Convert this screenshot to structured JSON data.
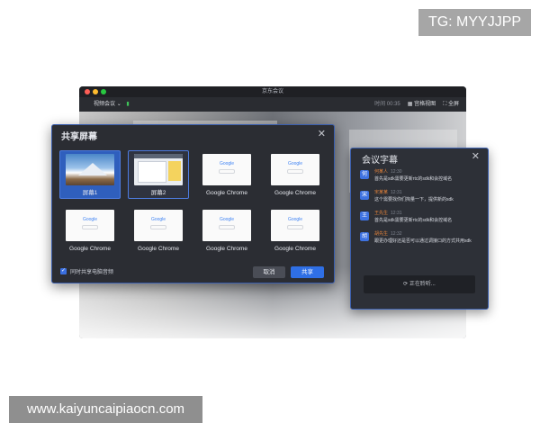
{
  "watermarks": {
    "top": "TG: MYYJJPP",
    "bottom": "www.kaiyuncaipiaocn.com"
  },
  "app_window": {
    "title": "京东会议",
    "toolbar_left": "视频会议",
    "toolbar_meta": "时间 00:35",
    "grid_view": "宫格视图",
    "fullscreen": "全屏"
  },
  "share_dialog": {
    "title": "共享屏幕",
    "tiles": [
      {
        "label": "屏幕1",
        "kind": "desktop",
        "state": "selected"
      },
      {
        "label": "屏幕2",
        "kind": "screen",
        "state": "hovered"
      },
      {
        "label": "Google Chrome",
        "kind": "chrome",
        "state": "normal"
      },
      {
        "label": "Google Chrome",
        "kind": "chrome",
        "state": "normal"
      },
      {
        "label": "Google Chrome",
        "kind": "chrome",
        "state": "normal"
      },
      {
        "label": "Google Chrome",
        "kind": "chrome",
        "state": "normal"
      },
      {
        "label": "Google Chrome",
        "kind": "chrome",
        "state": "normal"
      },
      {
        "label": "Google Chrome",
        "kind": "chrome",
        "state": "normal"
      }
    ],
    "google_text": "Google",
    "share_audio_label": "同时共享电脑音频",
    "share_audio_checked": true,
    "cancel_label": "取消",
    "share_label": "共享"
  },
  "captions": {
    "title": "会议字幕",
    "items": [
      {
        "avatar": "何",
        "name": "何某人",
        "time": "12:30",
        "text": "首先是sdk需要更新rtc的sdk和会控域名"
      },
      {
        "avatar": "宋",
        "name": "宋某某",
        "time": "12:31",
        "text": "这个需要找你们掏量一下，提供新的sdk"
      },
      {
        "avatar": "王",
        "name": "王先生",
        "time": "12:31",
        "text": "首先是sdk需要更新rtc的sdk和会控域名"
      },
      {
        "avatar": "胡",
        "name": "胡先生",
        "time": "12:32",
        "text": "跟更办理好还是否可以通过调接口的方式共用sdk"
      }
    ],
    "listening_label": "正在聆听..."
  },
  "colors": {
    "accent": "#2f6fe5",
    "dialog_bg": "#2b2d33",
    "name_orange": "#e0813a"
  }
}
